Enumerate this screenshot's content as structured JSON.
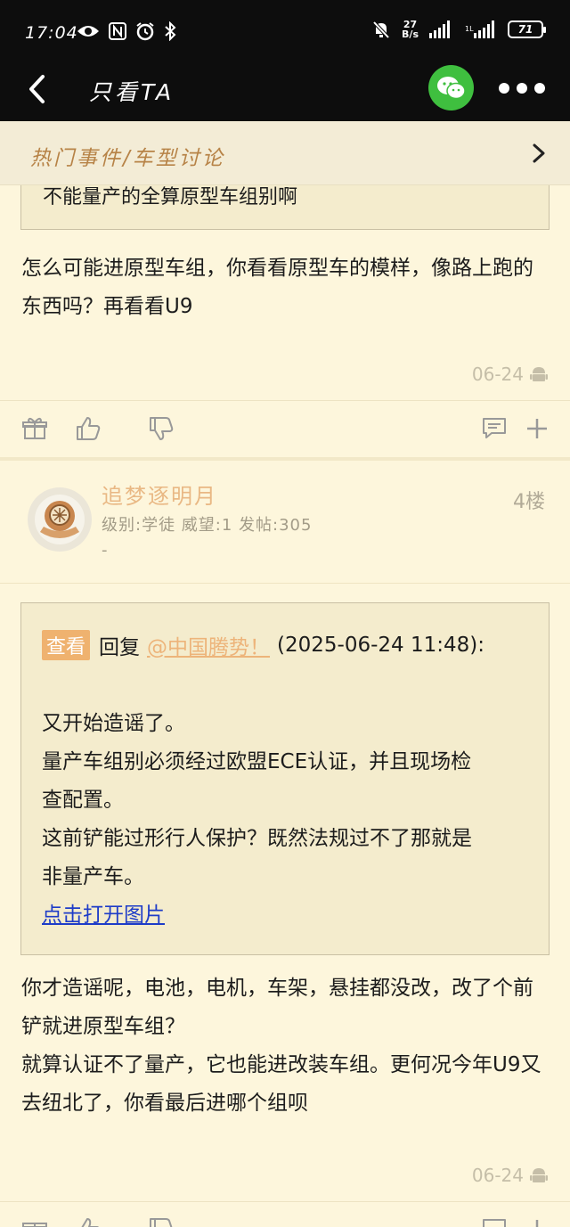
{
  "status_bar": {
    "time": "17:04",
    "net_speed_value": "27",
    "net_speed_unit": "B/s",
    "battery": "71"
  },
  "title_bar": {
    "title": "只看TA"
  },
  "forum_bar": {
    "breadcrumb": "热门事件/车型讨论"
  },
  "posts": [
    {
      "quote_partial": "不能量产的全算原型车组别啊",
      "text": "怎么可能进原型车组，你看看原型车的模样，像路上跑的东西吗？再看看U9",
      "date": "06-24"
    },
    {
      "author": {
        "name": "追梦逐明月",
        "meta": "级别:学徒  威望:1  发帖:305",
        "signature": "-"
      },
      "floor": "4楼",
      "quote": {
        "view_label": "查看",
        "reply_label": "回复",
        "mention": "@中国腾势！",
        "datetime": "(2025-06-24 11:48):",
        "lines": [
          "又开始造谣了。",
          "量产车组别必须经过欧盟ECE认证，并且现场检",
          "查配置。",
          "这前铲能过形行人保护？既然法规过不了那就是",
          "非量产车。"
        ],
        "link": "点击打开图片"
      },
      "text": "你才造谣呢，电池，电机，车架，悬挂都没改，改了个前铲就进原型车组？\n就算认证不了量产，它也能进改装车组。更何况今年U9又去纽北了，你看最后进哪个组呗",
      "date": "06-24"
    }
  ],
  "colors": {
    "page_bg": "#fdf6dc",
    "accent_orange": "#e9b884",
    "link_blue": "#1e3cc8",
    "wechat_green": "#3fbf3f"
  }
}
